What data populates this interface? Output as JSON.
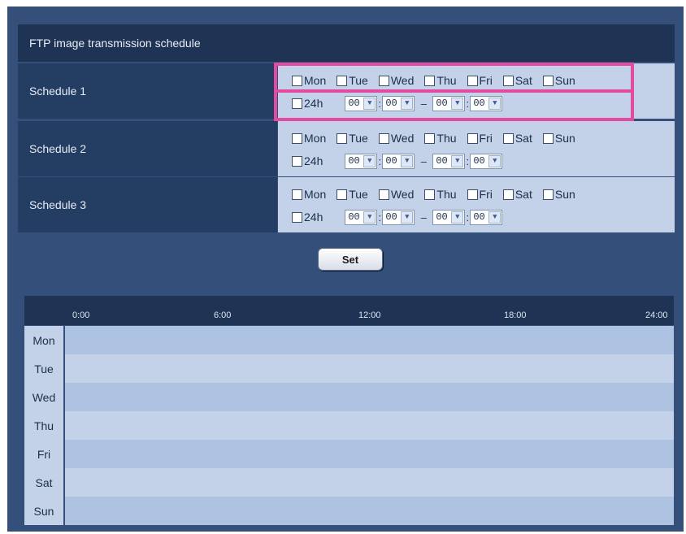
{
  "section": {
    "title": "FTP image transmission schedule"
  },
  "days": [
    "Mon",
    "Tue",
    "Wed",
    "Thu",
    "Fri",
    "Sat",
    "Sun"
  ],
  "schedules": [
    {
      "label": "Schedule 1",
      "all_day_label": "24h",
      "start_hour": "00",
      "start_min": "00",
      "end_hour": "00",
      "end_min": "00"
    },
    {
      "label": "Schedule 2",
      "all_day_label": "24h",
      "start_hour": "00",
      "start_min": "00",
      "end_hour": "00",
      "end_min": "00"
    },
    {
      "label": "Schedule 3",
      "all_day_label": "24h",
      "start_hour": "00",
      "start_min": "00",
      "end_hour": "00",
      "end_min": "00"
    }
  ],
  "separators": {
    "colon": ":",
    "dash": "–"
  },
  "set_button": {
    "label": "Set"
  },
  "timeline": {
    "ticks": [
      "0:00",
      "6:00",
      "12:00",
      "18:00",
      "24:00"
    ],
    "days": [
      "Mon",
      "Tue",
      "Wed",
      "Thu",
      "Fri",
      "Sat",
      "Sun"
    ]
  },
  "colors": {
    "panel_bg": "#34507a",
    "header_bg": "#1f3454",
    "label_bg": "#243d63",
    "option_bg": "#c3d2e8",
    "row_dark": "#adc3e1",
    "row_light": "#c3d2e8",
    "highlight": "#e44aa0"
  }
}
